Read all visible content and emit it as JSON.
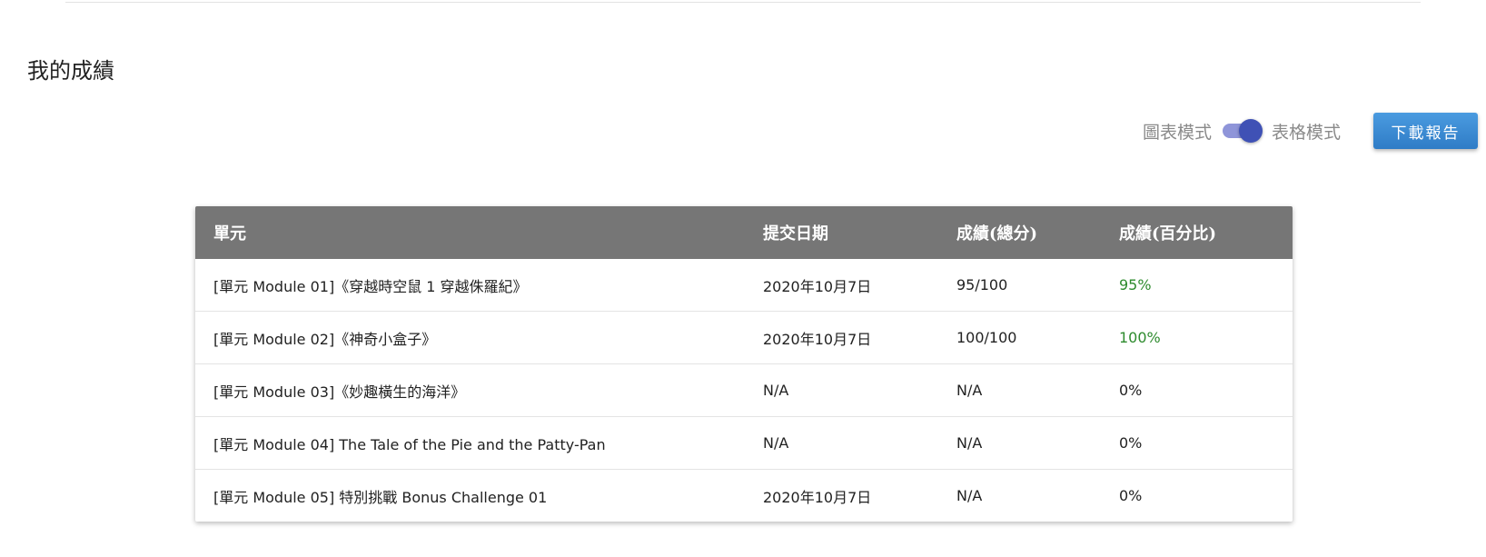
{
  "page": {
    "title": "我的成績"
  },
  "toolbar": {
    "chart_mode_label": "圖表模式",
    "table_mode_label": "表格模式",
    "download_label": "下載報告"
  },
  "table": {
    "headers": {
      "module": "單元",
      "date": "提交日期",
      "score": "成績(總分)",
      "percent": "成績(百分比)"
    },
    "rows": [
      {
        "module": "[單元 Module 01]《穿越時空鼠 1 穿越侏羅紀》",
        "date": "2020年10月7日",
        "score": "95/100",
        "percent": "95%"
      },
      {
        "module": "[單元 Module 02]《神奇小盒子》",
        "date": "2020年10月7日",
        "score": "100/100",
        "percent": "100%"
      },
      {
        "module": "[單元 Module 03]《妙趣橫生的海洋》",
        "date": "N/A",
        "score": "N/A",
        "percent": "0%"
      },
      {
        "module": "[單元 Module 04] The Tale of the Pie and the Patty-Pan",
        "date": "N/A",
        "score": "N/A",
        "percent": "0%"
      },
      {
        "module": "[單元 Module 05] 特別挑戰 Bonus Challenge 01",
        "date": "2020年10月7日",
        "score": "N/A",
        "percent": "0%"
      }
    ]
  },
  "colors": {
    "header_bg": "#767676",
    "switch_thumb": "#3f51b5",
    "switch_track": "#8f95d9",
    "button_bg": "#3a8bd4",
    "percent_good": "#2e8b2e"
  }
}
